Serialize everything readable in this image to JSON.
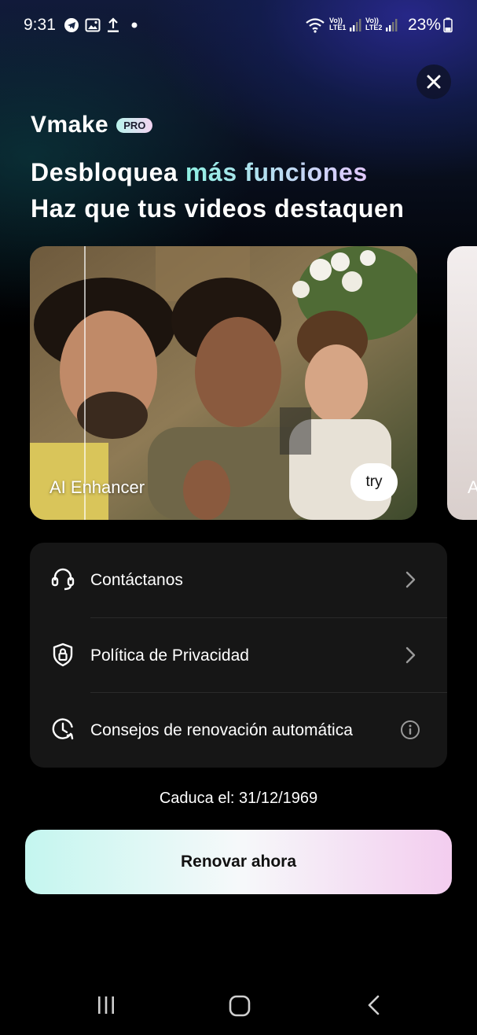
{
  "status_bar": {
    "time": "9:31",
    "sim1": "LTE1",
    "sim2": "LTE2",
    "volte": "Vo))",
    "battery_percent": "23%",
    "icons": [
      "telegram-icon",
      "gallery-icon",
      "upload-icon",
      "dot-icon",
      "wifi-icon",
      "signal-icon",
      "battery-icon"
    ]
  },
  "header": {
    "brand": "Vmake",
    "badge": "PRO",
    "headline_part1": "Desbloquea ",
    "headline_highlight": "más funciones",
    "headline_line2": "Haz que tus videos destaquen"
  },
  "carousel": {
    "cards": [
      {
        "label": "AI Enhancer",
        "button": "try"
      },
      {
        "label": "A"
      }
    ]
  },
  "menu": {
    "items": [
      {
        "label": "Contáctanos",
        "icon": "headset-icon",
        "trailing": "chevron-right-icon"
      },
      {
        "label": "Política de Privacidad",
        "icon": "shield-lock-icon",
        "trailing": "chevron-right-icon"
      },
      {
        "label": "Consejos de renovación automática",
        "icon": "clock-renew-icon",
        "trailing": "info-icon"
      }
    ]
  },
  "expiry_text": "Caduca el: 31/12/1969",
  "renew_button": "Renovar ahora",
  "colors": {
    "background": "#000000",
    "menu_bg": "#161616",
    "accent_start": "#8ff0e3",
    "accent_end": "#e2c8ff"
  }
}
